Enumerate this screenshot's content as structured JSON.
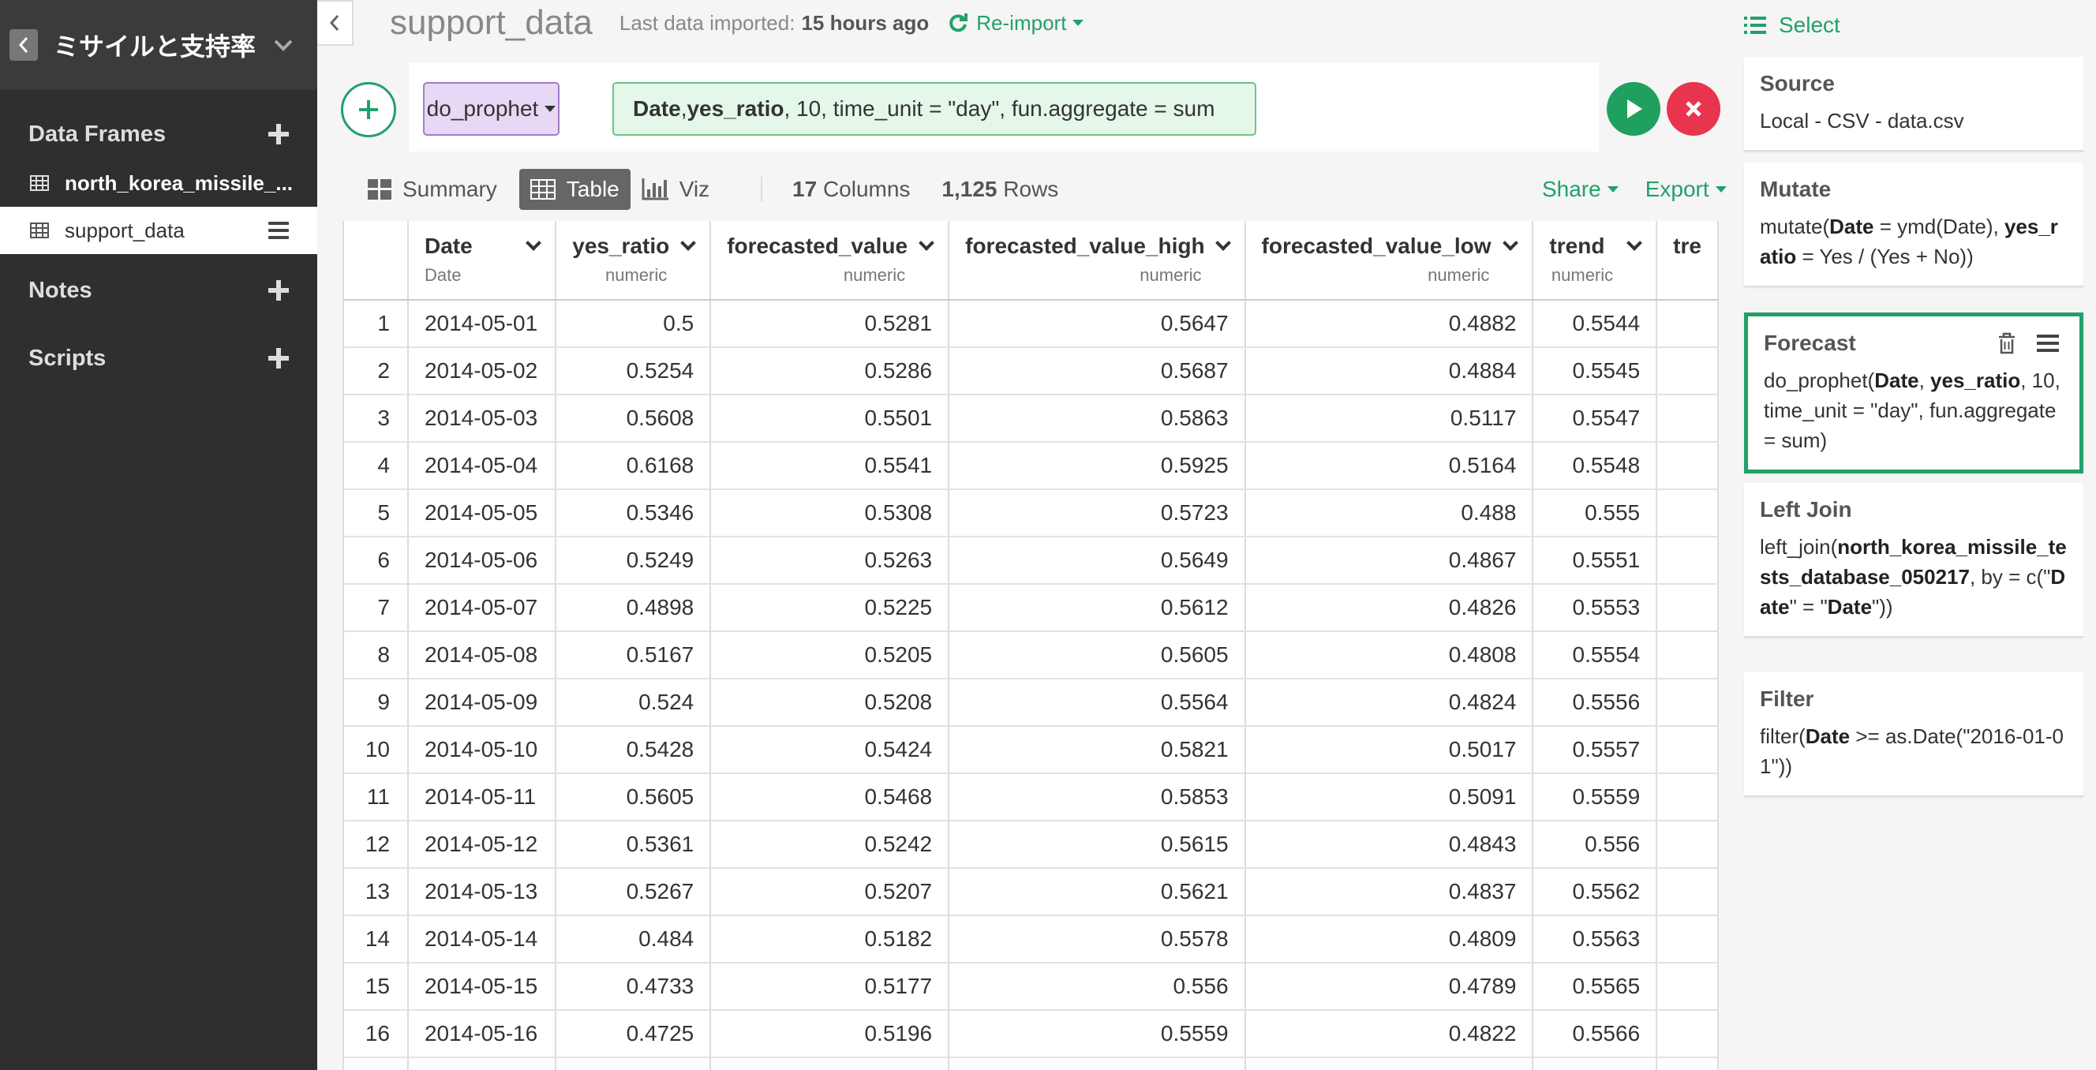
{
  "sidebar": {
    "project_name": "ミサイルと支持率",
    "sections": {
      "data_frames": "Data Frames",
      "notes": "Notes",
      "scripts": "Scripts"
    },
    "frames": [
      {
        "name": "north_korea_missile_..."
      },
      {
        "name": "support_data"
      }
    ]
  },
  "header": {
    "title": "support_data",
    "import_label": "Last data imported:",
    "import_time": "15 hours ago",
    "reimport": "Re-import"
  },
  "command": {
    "name": "do_prophet",
    "args": [
      {
        "t": "Date",
        "b": true
      },
      {
        "t": ", ",
        "b": false
      },
      {
        "t": "yes_ratio",
        "b": true
      },
      {
        "t": ", 10, time_unit = \"day\", fun.aggregate = sum",
        "b": false
      }
    ]
  },
  "view": {
    "tabs": [
      "Summary",
      "Table",
      "Viz"
    ],
    "active_tab": "Table",
    "columns_count": "17",
    "columns_label": "Columns",
    "rows_count": "1,125",
    "rows_label": "Rows",
    "share": "Share",
    "export": "Export"
  },
  "table": {
    "columns": [
      {
        "name": "Date",
        "type": "Date",
        "align": "left"
      },
      {
        "name": "yes_ratio",
        "type": "numeric",
        "align": "right"
      },
      {
        "name": "forecasted_value",
        "type": "numeric",
        "align": "right"
      },
      {
        "name": "forecasted_value_high",
        "type": "numeric",
        "align": "right"
      },
      {
        "name": "forecasted_value_low",
        "type": "numeric",
        "align": "right"
      },
      {
        "name": "trend",
        "type": "numeric",
        "align": "right"
      },
      {
        "name": "tre",
        "type": "",
        "align": "left"
      }
    ],
    "rows": [
      [
        "1",
        "2014-05-01",
        "0.5",
        "0.5281",
        "0.5647",
        "0.4882",
        "0.5544",
        ""
      ],
      [
        "2",
        "2014-05-02",
        "0.5254",
        "0.5286",
        "0.5687",
        "0.4884",
        "0.5545",
        ""
      ],
      [
        "3",
        "2014-05-03",
        "0.5608",
        "0.5501",
        "0.5863",
        "0.5117",
        "0.5547",
        ""
      ],
      [
        "4",
        "2014-05-04",
        "0.6168",
        "0.5541",
        "0.5925",
        "0.5164",
        "0.5548",
        ""
      ],
      [
        "5",
        "2014-05-05",
        "0.5346",
        "0.5308",
        "0.5723",
        "0.488",
        "0.555",
        ""
      ],
      [
        "6",
        "2014-05-06",
        "0.5249",
        "0.5263",
        "0.5649",
        "0.4867",
        "0.5551",
        ""
      ],
      [
        "7",
        "2014-05-07",
        "0.4898",
        "0.5225",
        "0.5612",
        "0.4826",
        "0.5553",
        ""
      ],
      [
        "8",
        "2014-05-08",
        "0.5167",
        "0.5205",
        "0.5605",
        "0.4808",
        "0.5554",
        ""
      ],
      [
        "9",
        "2014-05-09",
        "0.524",
        "0.5208",
        "0.5564",
        "0.4824",
        "0.5556",
        ""
      ],
      [
        "10",
        "2014-05-10",
        "0.5428",
        "0.5424",
        "0.5821",
        "0.5017",
        "0.5557",
        ""
      ],
      [
        "11",
        "2014-05-11",
        "0.5605",
        "0.5468",
        "0.5853",
        "0.5091",
        "0.5559",
        ""
      ],
      [
        "12",
        "2014-05-12",
        "0.5361",
        "0.5242",
        "0.5615",
        "0.4843",
        "0.556",
        ""
      ],
      [
        "13",
        "2014-05-13",
        "0.5267",
        "0.5207",
        "0.5621",
        "0.4837",
        "0.5562",
        ""
      ],
      [
        "14",
        "2014-05-14",
        "0.484",
        "0.5182",
        "0.5578",
        "0.4809",
        "0.5563",
        ""
      ],
      [
        "15",
        "2014-05-15",
        "0.4733",
        "0.5177",
        "0.556",
        "0.4789",
        "0.5565",
        ""
      ],
      [
        "16",
        "2014-05-16",
        "0.4725",
        "0.5196",
        "0.5559",
        "0.4822",
        "0.5566",
        ""
      ],
      [
        "",
        "",
        "",
        "",
        "",
        "",
        "",
        ""
      ]
    ]
  },
  "steps": {
    "select_label": "Select",
    "items": [
      {
        "title": "Source",
        "segments": [
          {
            "t": "Local - CSV - data.csv",
            "b": false
          }
        ]
      },
      {
        "title": "Mutate",
        "segments": [
          {
            "t": "mutate(",
            "b": false
          },
          {
            "t": "Date",
            "b": true
          },
          {
            "t": " = ymd(Date), ",
            "b": false
          },
          {
            "t": "yes_ratio",
            "b": true
          },
          {
            "t": " = Yes / (Yes + No))",
            "b": false
          }
        ]
      },
      {
        "title": "Forecast",
        "segments": [
          {
            "t": "do_prophet(",
            "b": false
          },
          {
            "t": "Date",
            "b": true
          },
          {
            "t": ", ",
            "b": false
          },
          {
            "t": "yes_ratio",
            "b": true
          },
          {
            "t": ", 10, time_unit = \"day\", fun.aggregate = sum)",
            "b": false
          }
        ]
      },
      {
        "title": "Left Join",
        "segments": [
          {
            "t": "left_join(",
            "b": false
          },
          {
            "t": "north_korea_missile_tests_database_050217",
            "b": true
          },
          {
            "t": ", by = c(\"",
            "b": false
          },
          {
            "t": "Date",
            "b": true
          },
          {
            "t": "\" = \"",
            "b": false
          },
          {
            "t": "Date",
            "b": true
          },
          {
            "t": "\"))",
            "b": false
          }
        ]
      },
      {
        "title": "Filter",
        "segments": [
          {
            "t": "filter(",
            "b": false
          },
          {
            "t": "Date",
            "b": true
          },
          {
            "t": " >= as.Date(\"2016-01-01\"))",
            "b": false
          }
        ]
      }
    ]
  },
  "colors": {
    "accent_green": "#22a06b",
    "run_green": "#1fa05e",
    "cancel_red": "#e8344d",
    "sidebar_bg": "#2f2f2f",
    "command_purple": "#e7d8f5"
  }
}
